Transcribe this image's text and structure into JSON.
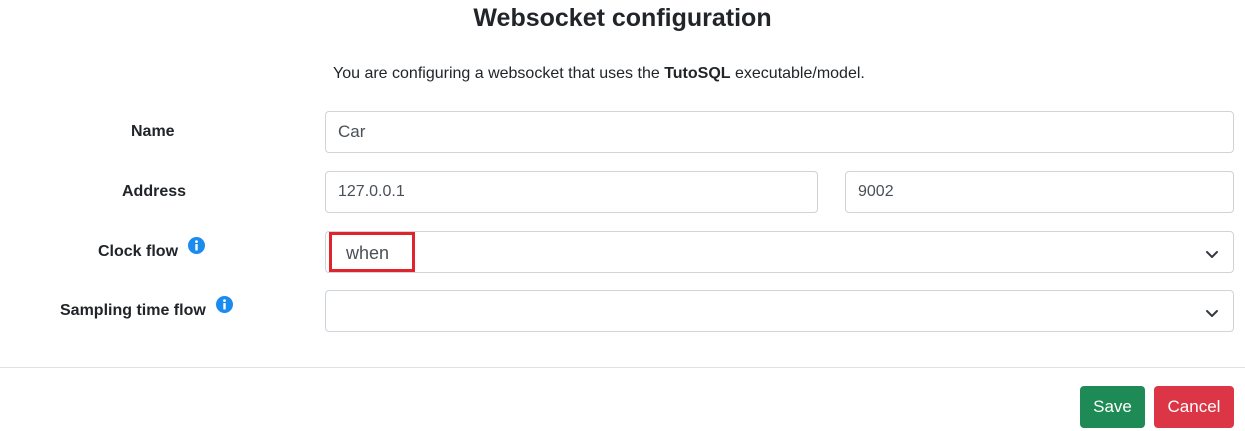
{
  "dialog": {
    "title": "Websocket configuration",
    "intro_prefix": "You are configuring a websocket that uses the ",
    "intro_model": "TutoSQL",
    "intro_suffix": " executable/model."
  },
  "form": {
    "name": {
      "label": "Name",
      "value": "Car"
    },
    "address": {
      "label": "Address",
      "host": "127.0.0.1",
      "port": "9002"
    },
    "clock_flow": {
      "label": "Clock flow",
      "selected": "when"
    },
    "sampling_time_flow": {
      "label": "Sampling time flow",
      "selected": ""
    }
  },
  "footer": {
    "save_label": "Save",
    "cancel_label": "Cancel"
  },
  "colors": {
    "info_icon": "#1a8cf0",
    "save_button": "#1e8a55",
    "cancel_button": "#dc3545",
    "highlight": "#e0242e"
  },
  "icons": {
    "info": "info-icon",
    "dropdown": "chevron-down-icon"
  }
}
